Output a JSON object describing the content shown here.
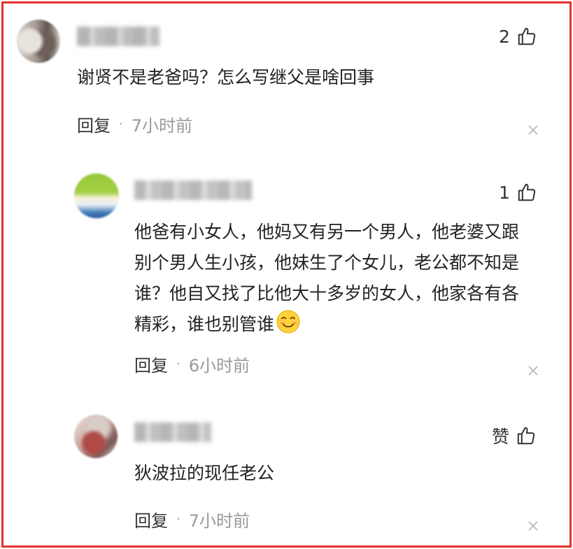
{
  "comments": [
    {
      "likes": "2",
      "text": "谢贤不是老爸吗？怎么写继父是啥回事",
      "reply_label": "回复",
      "separator": "·",
      "time": "7小时前"
    },
    {
      "likes": "1",
      "text": "他爸有小女人，他妈又有另一个男人，他老婆又跟别个男人生小孩，他妹生了个女儿，老公都不知是谁？他自又找了比他大十多岁的女人，他家各有各精彩，谁也别管谁",
      "emoji": "smiling-face-emoji",
      "reply_label": "回复",
      "separator": "·",
      "time": "6小时前"
    },
    {
      "likes": "赞",
      "text": "狄波拉的现任老公",
      "reply_label": "回复",
      "separator": "·",
      "time": "7小时前"
    }
  ],
  "colors": {
    "frame": "#e4332c",
    "text": "#222222",
    "meta": "#999999"
  },
  "icons": {
    "like": "thumbs-up-icon",
    "close": "close-icon"
  }
}
